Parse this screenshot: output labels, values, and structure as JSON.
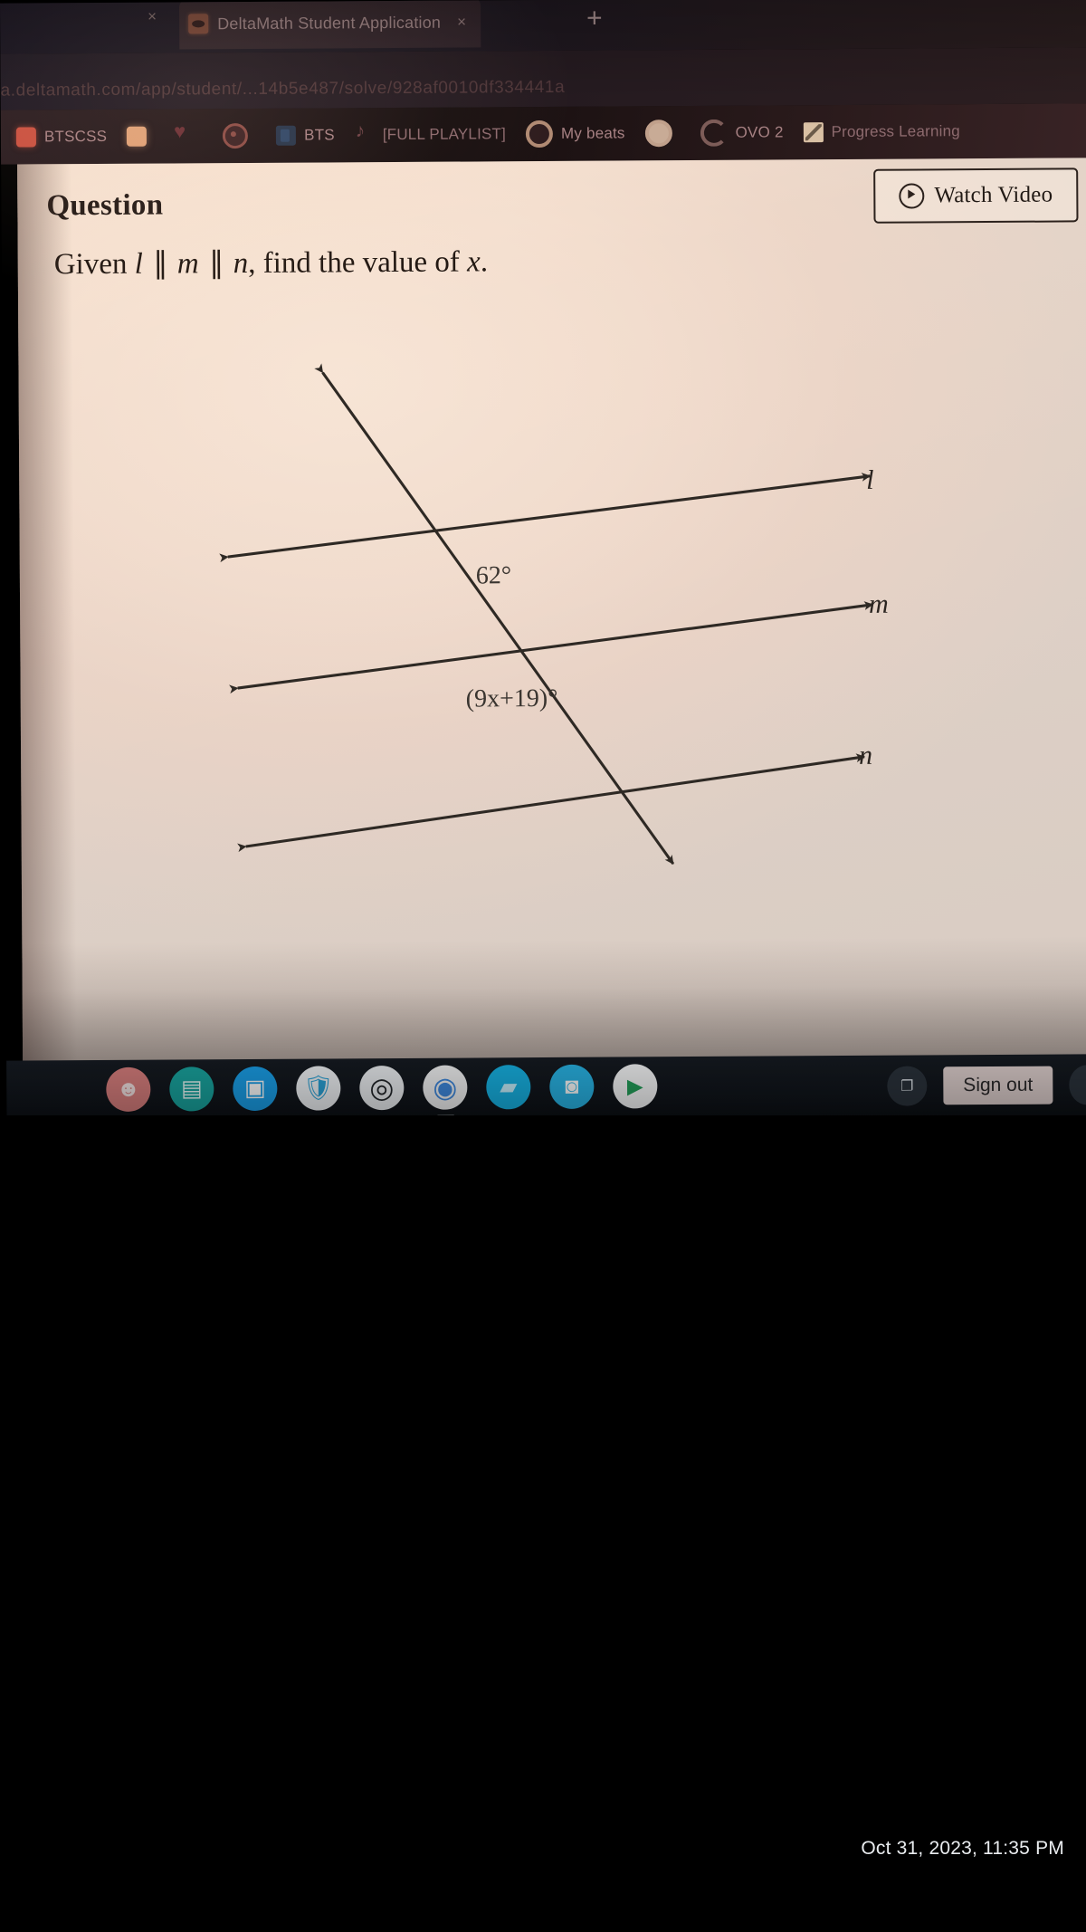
{
  "browser": {
    "tab": {
      "title": "DeltaMath Student Application",
      "favicon_icon": "deltamath-favicon",
      "close_icon": "close-icon",
      "left_close_icon": "close-icon"
    },
    "new_tab_label": "+",
    "omnibox_url": "a.deltamath.com/app/student/...14b5e487/solve/928af0010df334441a",
    "bookmarks": [
      {
        "label": "BTSCSS",
        "icon": "red-square-icon"
      },
      {
        "label": "",
        "icon": "peach-square-icon"
      },
      {
        "label": "",
        "icon": "heart-icon"
      },
      {
        "label": "",
        "icon": "circle-dot-icon"
      },
      {
        "label": "BTS",
        "icon": "blue-doc-icon"
      },
      {
        "label": "[FULL PLAYLIST]",
        "icon": "music-note-icon"
      },
      {
        "label": "My beats",
        "icon": "record-ring-icon"
      },
      {
        "label": "",
        "icon": "target-ring-icon"
      },
      {
        "label": "OVO 2",
        "icon": "spinner-icon"
      },
      {
        "label": "Progress Learning",
        "icon": "playlist-thumb-icon"
      }
    ]
  },
  "question": {
    "heading": "Question",
    "watch_video_label": "Watch Video",
    "watch_video_icon": "play-circle-icon",
    "prompt": {
      "lead": "Given",
      "line1": "l",
      "par1": "∥",
      "line2": "m",
      "par2": "∥",
      "line3": "n",
      "tail": ", find the value of",
      "variable": "x",
      "period": "."
    }
  },
  "diagram": {
    "labels": {
      "line_l": "l",
      "line_m": "m",
      "line_n": "n",
      "angle_known": "62°",
      "angle_unknown": "(9x+19)°"
    },
    "stroke_color": "#2e2924"
  },
  "shelf": {
    "apps": [
      {
        "name": "face-app-icon",
        "glyph": "☻"
      },
      {
        "name": "slides-app-icon",
        "glyph": "▤"
      },
      {
        "name": "zoom-app-icon",
        "glyph": "▣"
      },
      {
        "name": "shield-app-icon",
        "glyph": "🛡"
      },
      {
        "name": "target-app-icon",
        "glyph": "◎"
      },
      {
        "name": "chrome-app-icon",
        "glyph": "◉"
      },
      {
        "name": "files-app-icon",
        "glyph": "▰"
      },
      {
        "name": "camera-app-icon",
        "glyph": "◙"
      },
      {
        "name": "play-store-app-icon",
        "glyph": "▶"
      }
    ],
    "tray": {
      "screenshot_icon": "screen-capture-icon",
      "sign_out_label": "Sign out"
    }
  },
  "system": {
    "timestamp": "Oct 31, 2023, 11:35 PM"
  }
}
